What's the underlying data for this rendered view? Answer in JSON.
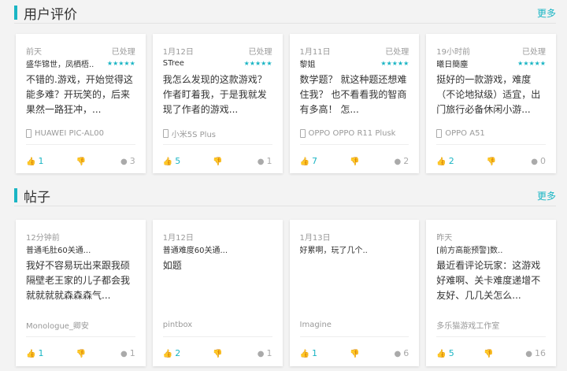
{
  "reviews": {
    "title": "用户评价",
    "more": "更多",
    "items": [
      {
        "time": "前天",
        "status": "已处理",
        "user": "盛华锦世，凤栖梧..",
        "stars": 5,
        "text": "不错的.游戏，开始觉得这能多难？开玩笑的，后来果然一路狂冲，...",
        "device": "HUAWEI PIC-AL00",
        "likes": "1",
        "comments": "3"
      },
      {
        "time": "1月12日",
        "status": "已处理",
        "user": "STree",
        "stars": 5,
        "text": "我怎么发现的这款游戏？作者盯着我，于是我就发现了作者的游戏...",
        "device": "小米5S Plus",
        "likes": "5",
        "comments": "1"
      },
      {
        "time": "1月11日",
        "status": "已处理",
        "user": "黎姐",
        "stars": 5,
        "text": "数学题？ 就这种题还想难住我？ 也不看看我的智商有多高！ 怎...",
        "device": "OPPO OPPO R11 Plusk",
        "likes": "7",
        "comments": "2"
      },
      {
        "time": "19小时前",
        "status": "已处理",
        "user": "曦日簡塵",
        "stars": 5,
        "text": "挺好的一款游戏，难度（不论地狱级）适宜，出门旅行必备休闲小游...",
        "device": "OPPO A51",
        "likes": "2",
        "comments": "0"
      }
    ]
  },
  "posts": {
    "title": "帖子",
    "more": "更多",
    "items": [
      {
        "time": "12分钟前",
        "subject": "普通毛肚60关通...",
        "text": "我好不容易玩出来跟我硕隔壁老王家的儿子都会我就就就就森森森气...",
        "author": "Monologue_卿安",
        "likes": "1",
        "comments": "1"
      },
      {
        "time": "1月12日",
        "subject": "普通难度60关通...",
        "text": "如题",
        "author": "pintbox",
        "likes": "2",
        "comments": "1"
      },
      {
        "time": "1月13日",
        "subject": "好累啊，玩了几个..",
        "text": "",
        "author": "Imagine",
        "likes": "1",
        "comments": "6"
      },
      {
        "time": "昨天",
        "subject": "[前方高能预警]数..",
        "text": "最近看评论玩家：这游戏好难啊、关卡难度递增不友好、几几关怎么...",
        "author": "多乐猫游戏工作室",
        "likes": "5",
        "comments": "16"
      }
    ]
  }
}
